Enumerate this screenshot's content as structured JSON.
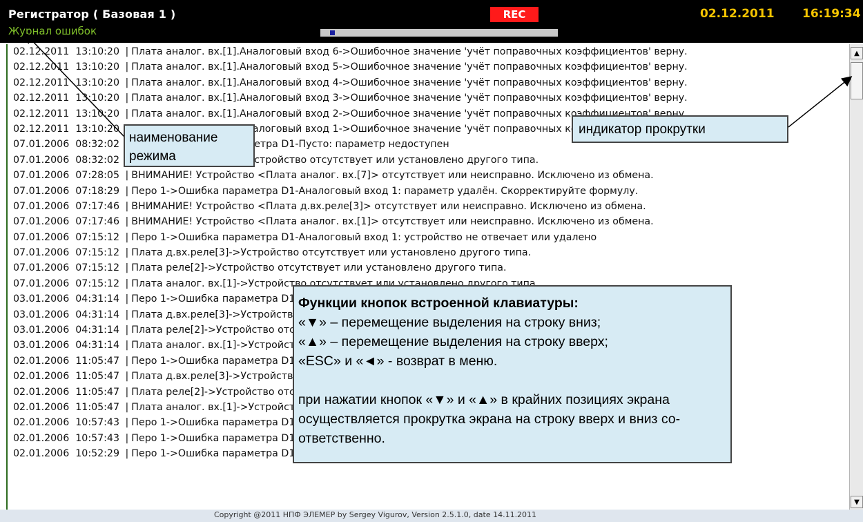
{
  "header": {
    "app_title": "Регистратор ( Базовая 1 )",
    "mode_title": "Журнал ошибок",
    "rec_label": "REC",
    "date": "02.12.2011",
    "time": "16:19:34",
    "progress_fraction": 0.05
  },
  "log": [
    {
      "date": "02.12.2011",
      "time": "13:10:20",
      "message": "Плата аналог. вх.[1].Аналоговый вход 6->Ошибочное значение 'учёт поправочных коэффициентов' верну."
    },
    {
      "date": "02.12.2011",
      "time": "13:10:20",
      "message": "Плата аналог. вх.[1].Аналоговый вход 5->Ошибочное значение 'учёт поправочных коэффициентов' верну."
    },
    {
      "date": "02.12.2011",
      "time": "13:10:20",
      "message": "Плата аналог. вх.[1].Аналоговый вход 4->Ошибочное значение 'учёт поправочных коэффициентов' верну."
    },
    {
      "date": "02.12.2011",
      "time": "13:10:20",
      "message": "Плата аналог. вх.[1].Аналоговый вход 3->Ошибочное значение 'учёт поправочных коэффициентов' верну."
    },
    {
      "date": "02.12.2011",
      "time": "13:10:20",
      "message": "Плата аналог. вх.[1].Аналоговый вход 2->Ошибочное значение 'учёт поправочных коэффициентов' верну."
    },
    {
      "date": "02.12.2011",
      "time": "13:10:20",
      "message": "Плата аналог. вх.[1].Аналоговый вход 1->Ошибочное значение 'учёт поправочных коэффициентов' верну."
    },
    {
      "date": "07.01.2006",
      "time": "08:32:02",
      "message": "Перо 1->Ошибка параметра D1-Пусто: параметр недоступен"
    },
    {
      "date": "07.01.2006",
      "time": "08:32:02",
      "message": "Плата аналог. вх.[7]->Устройство отсутствует или установлено другого типа."
    },
    {
      "date": "07.01.2006",
      "time": "07:28:05",
      "message": "ВНИМАНИЕ! Устройство <Плата аналог. вх.[7]> отсутствует или неисправно. Исключено из обмена."
    },
    {
      "date": "07.01.2006",
      "time": "07:18:29",
      "message": "Перо 1->Ошибка параметра D1-Аналоговый вход 1: параметр удалён. Скорректируйте формулу."
    },
    {
      "date": "07.01.2006",
      "time": "07:17:46",
      "message": "ВНИМАНИЕ! Устройство <Плата д.вх.реле[3]> отсутствует или неисправно. Исключено из обмена."
    },
    {
      "date": "07.01.2006",
      "time": "07:17:46",
      "message": "ВНИМАНИЕ! Устройство <Плата аналог. вх.[1]> отсутствует или неисправно. Исключено из обмена."
    },
    {
      "date": "07.01.2006",
      "time": "07:15:12",
      "message": "Перо 1->Ошибка параметра D1-Аналоговый вход 1: устройство не отвечает или удалено"
    },
    {
      "date": "07.01.2006",
      "time": "07:15:12",
      "message": "Плата д.вх.реле[3]->Устройство отсутствует или установлено другого типа."
    },
    {
      "date": "07.01.2006",
      "time": "07:15:12",
      "message": "Плата реле[2]->Устройство отсутствует или установлено другого типа."
    },
    {
      "date": "07.01.2006",
      "time": "07:15:12",
      "message": "Плата аналог. вх.[1]->Устройство отсутствует или установлено другого типа."
    },
    {
      "date": "03.01.2006",
      "time": "04:31:14",
      "message": "Перо 1->Ошибка параметра D1-Аналоговый вход 1: устройство не отвечает или удалено"
    },
    {
      "date": "03.01.2006",
      "time": "04:31:14",
      "message": "Плата д.вх.реле[3]->Устройство отсутствует или установлено другого типа."
    },
    {
      "date": "03.01.2006",
      "time": "04:31:14",
      "message": "Плата реле[2]->Устройство отсутствует или установлено другого типа."
    },
    {
      "date": "03.01.2006",
      "time": "04:31:14",
      "message": "Плата аналог. вх.[1]->Устройство отсутствует или установлено другого типа."
    },
    {
      "date": "02.01.2006",
      "time": "11:05:47",
      "message": "Перо 1->Ошибка параметра D1-Аналоговый вход 1: устройство не отвечает или удалено"
    },
    {
      "date": "02.01.2006",
      "time": "11:05:47",
      "message": "Плата д.вх.реле[3]->Устройство отсутствует или установлено другого типа."
    },
    {
      "date": "02.01.2006",
      "time": "11:05:47",
      "message": "Плата реле[2]->Устройство отсутствует или установлено другого типа."
    },
    {
      "date": "02.01.2006",
      "time": "11:05:47",
      "message": "Плата аналог. вх.[1]->Устройство отсутствует или установлено другого типа."
    },
    {
      "date": "02.01.2006",
      "time": "10:57:43",
      "message": "Перо 1->Ошибка параметра D1-Аналоговый вход 1: -AL- (выход значения канала за диапазон)"
    },
    {
      "date": "02.01.2006",
      "time": "10:57:43",
      "message": "Перо 1->Ошибка параметра D1-Аналоговый вход 1: ошибка АЦП"
    },
    {
      "date": "02.01.2006",
      "time": "10:52:29",
      "message": "Перо 1->Ошибка параметра D1-Аналоговый вход 1: -AL- (выход значения канала за диапазон)"
    }
  ],
  "scrollbar": {
    "up_icon": "▲",
    "down_icon": "▼"
  },
  "footer": {
    "copyright": "Copyright @2011 НПФ ЭЛЕМЕР  by Sergey Vigurov, Version 2.5.1.0, date 14.11.2011"
  },
  "callouts": {
    "mode_name": "наименование режима",
    "scroll_indicator": "индикатор прокрутки",
    "keys_heading": "Функции кнопок встроенной клавиатуры:",
    "keys_line1": "«▼» – перемещение выделения на строку вниз;",
    "keys_line2": "«▲» – перемещение выделения на строку вверх;",
    "keys_line3": "«ESC» и «◄» - возврат в меню.",
    "keys_note": "при нажатии кнопок «▼» и «▲» в крайних позициях экрана осуществляется прокрутка экрана на строку вверх и вниз со-ответственно."
  },
  "colors": {
    "header_bg": "#000000",
    "mode_title": "#7fbf2a",
    "rec_bg": "#ff1a1a",
    "clock": "#f5c400",
    "callout_bg": "#d7ebf4"
  }
}
